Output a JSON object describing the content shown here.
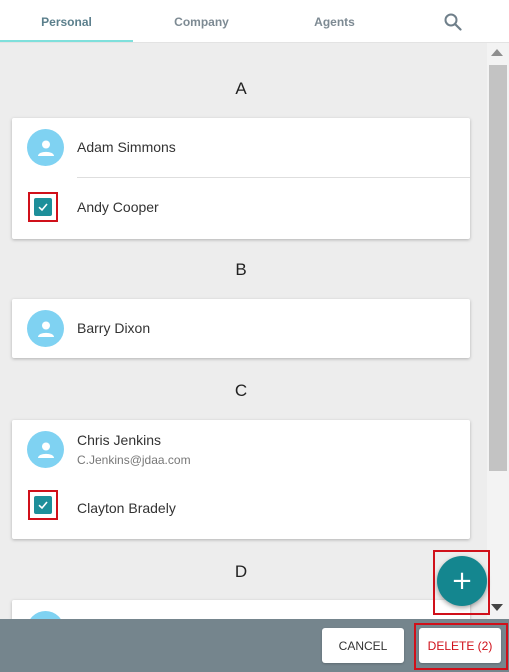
{
  "tabs": [
    {
      "label": "Personal",
      "active": true
    },
    {
      "label": "Company",
      "active": false
    },
    {
      "label": "Agents",
      "active": false
    }
  ],
  "search_icon": "search-icon",
  "sections": [
    {
      "letter": "A",
      "contacts": [
        {
          "name": "Adam Simmons",
          "selected": false
        },
        {
          "name": "Andy Cooper",
          "selected": true
        }
      ]
    },
    {
      "letter": "B",
      "contacts": [
        {
          "name": "Barry Dixon",
          "selected": false
        }
      ]
    },
    {
      "letter": "C",
      "contacts": [
        {
          "name": "Chris Jenkins",
          "email": "C.Jenkins@jdaa.com",
          "selected": false
        },
        {
          "name": "Clayton Bradely",
          "selected": true
        }
      ]
    },
    {
      "letter": "D",
      "contacts": []
    }
  ],
  "fab": {
    "label": "+"
  },
  "footer": {
    "cancel_label": "CANCEL",
    "delete_label": "DELETE (2)"
  },
  "colors": {
    "accent": "#14868f",
    "tab_indicator": "#7fe0dc",
    "avatar": "#7fd2f2",
    "footer": "#75858d",
    "danger": "#d0101a"
  }
}
